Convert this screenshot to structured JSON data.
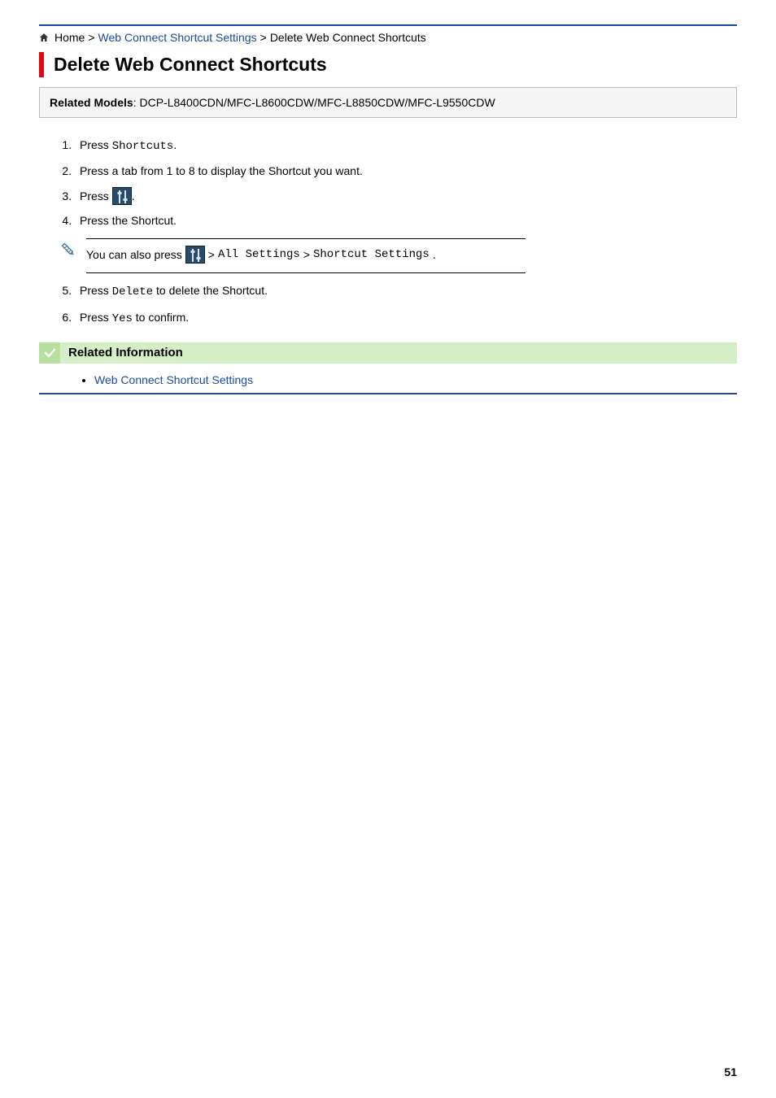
{
  "breadcrumb": {
    "home": "Home",
    "sep": ">",
    "link1": "Web Connect Shortcut Settings",
    "current": "Delete Web Connect Shortcuts"
  },
  "heading": "Delete Web Connect Shortcuts",
  "models": {
    "label": "Related Models",
    "value": ": DCP-L8400CDN/MFC-L8600CDW/MFC-L8850CDW/MFC-L9550CDW"
  },
  "steps": {
    "s1_a": "Press ",
    "s1_b": "Shortcuts",
    "s1_c": ".",
    "s2": "Press a tab from 1 to 8 to display the Shortcut you want.",
    "s3_a": "Press ",
    "s3_b": ".",
    "s4": "Press the Shortcut.",
    "s5_a": "Press ",
    "s5_b": "Delete",
    "s5_c": " to delete the Shortcut.",
    "s6_a": "Press ",
    "s6_b": "Yes",
    "s6_c": " to confirm."
  },
  "note": {
    "a": "You can also press ",
    "sep": " > ",
    "b": "All Settings",
    "c": "Shortcut Settings",
    "d": "."
  },
  "related": {
    "title": "Related Information",
    "item1": "Web Connect Shortcut Settings"
  },
  "page_number": "51"
}
